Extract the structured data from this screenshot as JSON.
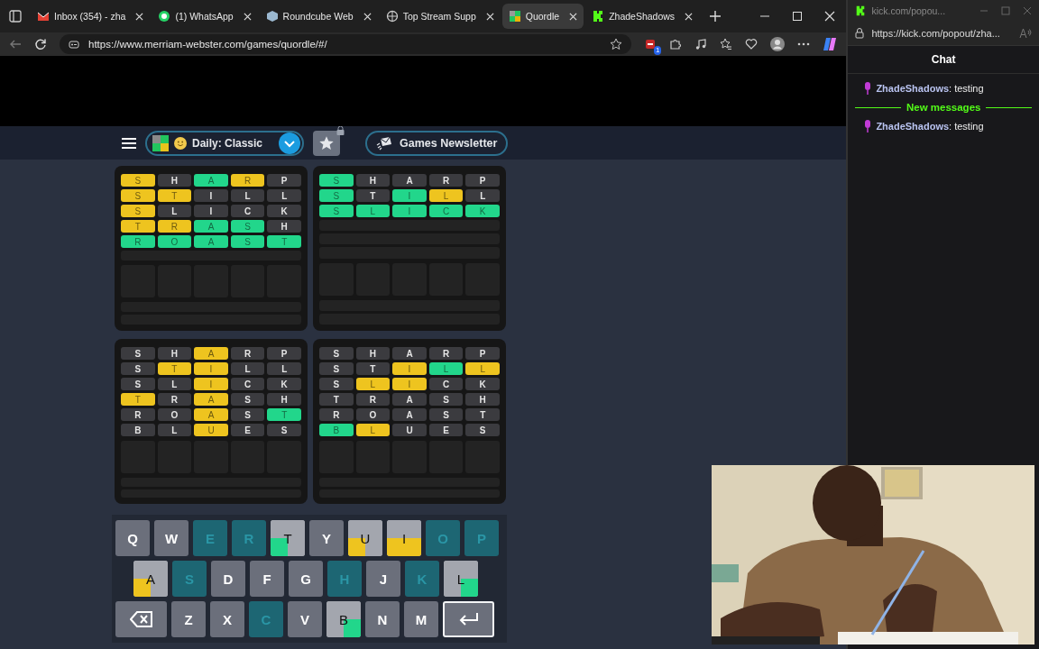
{
  "browser": {
    "tabs": [
      {
        "label": "Inbox (354) - zha",
        "selected": false
      },
      {
        "label": "(1) WhatsApp",
        "selected": false
      },
      {
        "label": "Roundcube Web",
        "selected": false
      },
      {
        "label": "Top Stream Supp",
        "selected": false
      },
      {
        "label": "Quordle",
        "selected": true
      },
      {
        "label": "ZhadeShadows",
        "selected": false
      }
    ],
    "address": "https://www.merriam-webster.com/games/quordle/#/",
    "extension_badge": "1"
  },
  "game": {
    "mode": "Daily: Classic",
    "newsletter": "Games Newsletter",
    "boards": [
      {
        "rows": [
          [
            {
              "letter": "S",
              "correct": false,
              "present": true
            },
            {
              "letter": "H",
              "correct": false,
              "present": false
            },
            {
              "letter": "A",
              "correct": true,
              "present": false
            },
            {
              "letter": "R",
              "correct": false,
              "present": true
            },
            {
              "letter": "P",
              "correct": false,
              "present": false
            }
          ],
          [
            {
              "letter": "S",
              "correct": false,
              "present": true
            },
            {
              "letter": "T",
              "correct": false,
              "present": true
            },
            {
              "letter": "I",
              "correct": false,
              "present": false
            },
            {
              "letter": "L",
              "correct": false,
              "present": false
            },
            {
              "letter": "L",
              "correct": false,
              "present": false
            }
          ],
          [
            {
              "letter": "S",
              "correct": false,
              "present": true
            },
            {
              "letter": "L",
              "correct": false,
              "present": false
            },
            {
              "letter": "I",
              "correct": false,
              "present": false
            },
            {
              "letter": "C",
              "correct": false,
              "present": false
            },
            {
              "letter": "K",
              "correct": false,
              "present": false
            }
          ],
          [
            {
              "letter": "T",
              "correct": false,
              "present": true
            },
            {
              "letter": "R",
              "correct": false,
              "present": true
            },
            {
              "letter": "A",
              "correct": true,
              "present": false
            },
            {
              "letter": "S",
              "correct": true,
              "present": false
            },
            {
              "letter": "H",
              "correct": false,
              "present": false
            }
          ],
          [
            {
              "letter": "R",
              "correct": true,
              "present": false
            },
            {
              "letter": "O",
              "correct": true,
              "present": false
            },
            {
              "letter": "A",
              "correct": true,
              "present": false
            },
            {
              "letter": "S",
              "correct": true,
              "present": false
            },
            {
              "letter": "T",
              "correct": true,
              "present": false
            }
          ]
        ]
      },
      {
        "rows": [
          [
            {
              "letter": "S",
              "correct": true,
              "present": false
            },
            {
              "letter": "H",
              "correct": false,
              "present": false
            },
            {
              "letter": "A",
              "correct": false,
              "present": false
            },
            {
              "letter": "R",
              "correct": false,
              "present": false
            },
            {
              "letter": "P",
              "correct": false,
              "present": false
            }
          ],
          [
            {
              "letter": "S",
              "correct": true,
              "present": false
            },
            {
              "letter": "T",
              "correct": false,
              "present": false
            },
            {
              "letter": "I",
              "correct": true,
              "present": false
            },
            {
              "letter": "L",
              "correct": false,
              "present": true
            },
            {
              "letter": "L",
              "correct": false,
              "present": false
            }
          ],
          [
            {
              "letter": "S",
              "correct": true,
              "present": false
            },
            {
              "letter": "L",
              "correct": true,
              "present": false
            },
            {
              "letter": "I",
              "correct": true,
              "present": false
            },
            {
              "letter": "C",
              "correct": true,
              "present": false
            },
            {
              "letter": "K",
              "correct": true,
              "present": false
            }
          ]
        ]
      },
      {
        "rows": [
          [
            {
              "letter": "S",
              "correct": false,
              "present": false
            },
            {
              "letter": "H",
              "correct": false,
              "present": false
            },
            {
              "letter": "A",
              "correct": false,
              "present": true
            },
            {
              "letter": "R",
              "correct": false,
              "present": false
            },
            {
              "letter": "P",
              "correct": false,
              "present": false
            }
          ],
          [
            {
              "letter": "S",
              "correct": false,
              "present": false
            },
            {
              "letter": "T",
              "correct": false,
              "present": true
            },
            {
              "letter": "I",
              "correct": false,
              "present": true
            },
            {
              "letter": "L",
              "correct": false,
              "present": false
            },
            {
              "letter": "L",
              "correct": false,
              "present": false
            }
          ],
          [
            {
              "letter": "S",
              "correct": false,
              "present": false
            },
            {
              "letter": "L",
              "correct": false,
              "present": false
            },
            {
              "letter": "I",
              "correct": false,
              "present": true
            },
            {
              "letter": "C",
              "correct": false,
              "present": false
            },
            {
              "letter": "K",
              "correct": false,
              "present": false
            }
          ],
          [
            {
              "letter": "T",
              "correct": false,
              "present": true
            },
            {
              "letter": "R",
              "correct": false,
              "present": false
            },
            {
              "letter": "A",
              "correct": false,
              "present": true
            },
            {
              "letter": "S",
              "correct": false,
              "present": false
            },
            {
              "letter": "H",
              "correct": false,
              "present": false
            }
          ],
          [
            {
              "letter": "R",
              "correct": false,
              "present": false
            },
            {
              "letter": "O",
              "correct": false,
              "present": false
            },
            {
              "letter": "A",
              "correct": false,
              "present": true
            },
            {
              "letter": "S",
              "correct": false,
              "present": false
            },
            {
              "letter": "T",
              "correct": true,
              "present": false
            }
          ],
          [
            {
              "letter": "B",
              "correct": false,
              "present": false
            },
            {
              "letter": "L",
              "correct": false,
              "present": false
            },
            {
              "letter": "U",
              "correct": false,
              "present": true
            },
            {
              "letter": "E",
              "correct": false,
              "present": false
            },
            {
              "letter": "S",
              "correct": false,
              "present": false
            }
          ]
        ]
      },
      {
        "rows": [
          [
            {
              "letter": "S",
              "correct": false,
              "present": false
            },
            {
              "letter": "H",
              "correct": false,
              "present": false
            },
            {
              "letter": "A",
              "correct": false,
              "present": false
            },
            {
              "letter": "R",
              "correct": false,
              "present": false
            },
            {
              "letter": "P",
              "correct": false,
              "present": false
            }
          ],
          [
            {
              "letter": "S",
              "correct": false,
              "present": false
            },
            {
              "letter": "T",
              "correct": false,
              "present": false
            },
            {
              "letter": "I",
              "correct": false,
              "present": true
            },
            {
              "letter": "L",
              "correct": true,
              "present": false
            },
            {
              "letter": "L",
              "correct": false,
              "present": true
            }
          ],
          [
            {
              "letter": "S",
              "correct": false,
              "present": false
            },
            {
              "letter": "L",
              "correct": false,
              "present": true
            },
            {
              "letter": "I",
              "correct": false,
              "present": true
            },
            {
              "letter": "C",
              "correct": false,
              "present": false
            },
            {
              "letter": "K",
              "correct": false,
              "present": false
            }
          ],
          [
            {
              "letter": "T",
              "correct": false,
              "present": false
            },
            {
              "letter": "R",
              "correct": false,
              "present": false
            },
            {
              "letter": "A",
              "correct": false,
              "present": false
            },
            {
              "letter": "S",
              "correct": false,
              "present": false
            },
            {
              "letter": "H",
              "correct": false,
              "present": false
            }
          ],
          [
            {
              "letter": "R",
              "correct": false,
              "present": false
            },
            {
              "letter": "O",
              "correct": false,
              "present": false
            },
            {
              "letter": "A",
              "correct": false,
              "present": false
            },
            {
              "letter": "S",
              "correct": false,
              "present": false
            },
            {
              "letter": "T",
              "correct": false,
              "present": false
            }
          ],
          [
            {
              "letter": "B",
              "correct": true,
              "present": false
            },
            {
              "letter": "L",
              "correct": false,
              "present": true
            },
            {
              "letter": "U",
              "correct": false,
              "present": false
            },
            {
              "letter": "E",
              "correct": false,
              "present": false
            },
            {
              "letter": "S",
              "correct": false,
              "present": false
            }
          ]
        ]
      }
    ],
    "keyboard": [
      [
        {
          "kind": "letter",
          "label": "Q",
          "absent": false
        },
        {
          "kind": "letter",
          "label": "W",
          "absent": false
        },
        {
          "kind": "letter",
          "label": "E",
          "absent": true
        },
        {
          "kind": "letter",
          "label": "R",
          "absent": true
        },
        {
          "kind": "letter",
          "label": "T",
          "absent": false,
          "quads": [
            {
              "correct": false,
              "present": false
            },
            {
              "correct": false,
              "present": false
            },
            {
              "correct": true,
              "present": false
            },
            {
              "correct": false,
              "present": false
            }
          ]
        },
        {
          "kind": "letter",
          "label": "Y",
          "absent": false
        },
        {
          "kind": "letter",
          "label": "U",
          "absent": false,
          "quads": [
            {
              "correct": false,
              "present": false
            },
            {
              "correct": false,
              "present": false
            },
            {
              "correct": false,
              "present": true
            },
            {
              "correct": false,
              "present": false
            }
          ]
        },
        {
          "kind": "letter",
          "label": "I",
          "absent": false,
          "quads": [
            {
              "correct": false,
              "present": false
            },
            {
              "correct": false,
              "present": false
            },
            {
              "correct": false,
              "present": true
            },
            {
              "correct": false,
              "present": true
            }
          ]
        },
        {
          "kind": "letter",
          "label": "O",
          "absent": true
        },
        {
          "kind": "letter",
          "label": "P",
          "absent": true
        }
      ],
      [
        {
          "kind": "letter",
          "label": "A",
          "absent": false,
          "quads": [
            {
              "correct": false,
              "present": false
            },
            {
              "correct": false,
              "present": false
            },
            {
              "correct": false,
              "present": true
            },
            {
              "correct": false,
              "present": false
            }
          ]
        },
        {
          "kind": "letter",
          "label": "S",
          "absent": true
        },
        {
          "kind": "letter",
          "label": "D",
          "absent": false
        },
        {
          "kind": "letter",
          "label": "F",
          "absent": false
        },
        {
          "kind": "letter",
          "label": "G",
          "absent": false
        },
        {
          "kind": "letter",
          "label": "H",
          "absent": true
        },
        {
          "kind": "letter",
          "label": "J",
          "absent": false
        },
        {
          "kind": "letter",
          "label": "K",
          "absent": true
        },
        {
          "kind": "letter",
          "label": "L",
          "absent": false,
          "quads": [
            {
              "correct": false,
              "present": false
            },
            {
              "correct": false,
              "present": false
            },
            {
              "correct": false,
              "present": false
            },
            {
              "correct": true,
              "present": false
            }
          ]
        }
      ],
      [
        {
          "kind": "backspace"
        },
        {
          "kind": "letter",
          "label": "Z",
          "absent": false
        },
        {
          "kind": "letter",
          "label": "X",
          "absent": false
        },
        {
          "kind": "letter",
          "label": "C",
          "absent": true
        },
        {
          "kind": "letter",
          "label": "V",
          "absent": false
        },
        {
          "kind": "letter",
          "label": "B",
          "absent": false,
          "quads": [
            {
              "correct": false,
              "present": false
            },
            {
              "correct": false,
              "present": false
            },
            {
              "correct": false,
              "present": false
            },
            {
              "correct": true,
              "present": false
            }
          ]
        },
        {
          "kind": "letter",
          "label": "N",
          "absent": false
        },
        {
          "kind": "letter",
          "label": "M",
          "absent": false
        },
        {
          "kind": "enter",
          "focused": true
        }
      ]
    ]
  },
  "popup": {
    "title": "kick.com/popou...",
    "address": "https://kick.com/popout/zha...",
    "chat_title": "Chat",
    "messages": [
      {
        "kind": "message",
        "user": "ZhadeShadows",
        "text": ": testing"
      },
      {
        "kind": "divider",
        "text": "New messages"
      },
      {
        "kind": "message",
        "user": "ZhadeShadows",
        "text": ": testing"
      }
    ]
  }
}
